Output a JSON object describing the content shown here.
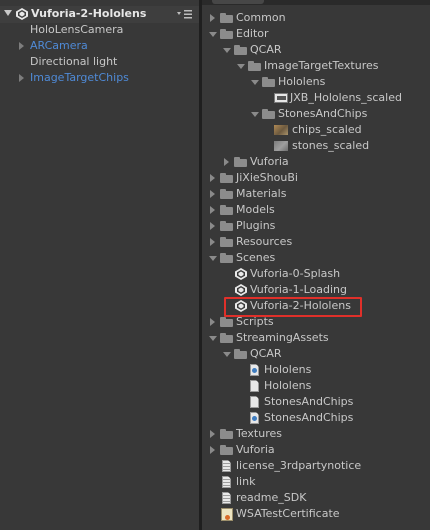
{
  "hierarchy": {
    "scene_name": "Vuforia-2-Hololens",
    "items": [
      {
        "label": "HoloLensCamera"
      },
      {
        "label": "ARCamera"
      },
      {
        "label": "Directional light"
      },
      {
        "label": "ImageTargetChips"
      }
    ]
  },
  "project": {
    "tree": [
      {
        "label": "Common"
      },
      {
        "label": "Editor"
      },
      {
        "label": "QCAR"
      },
      {
        "label": "ImageTargetTextures"
      },
      {
        "label": "Hololens"
      },
      {
        "label": "JXB_Hololens_scaled"
      },
      {
        "label": "StonesAndChips"
      },
      {
        "label": "chips_scaled"
      },
      {
        "label": "stones_scaled"
      },
      {
        "label": "Vuforia"
      },
      {
        "label": "JiXieShouBi"
      },
      {
        "label": "Materials"
      },
      {
        "label": "Models"
      },
      {
        "label": "Plugins"
      },
      {
        "label": "Resources"
      },
      {
        "label": "Scenes"
      },
      {
        "label": "Vuforia-0-Splash"
      },
      {
        "label": "Vuforia-1-Loading"
      },
      {
        "label": "Vuforia-2-Hololens"
      },
      {
        "label": "Scripts"
      },
      {
        "label": "StreamingAssets"
      },
      {
        "label": "QCAR"
      },
      {
        "label": "Hololens"
      },
      {
        "label": "Hololens"
      },
      {
        "label": "StonesAndChips"
      },
      {
        "label": "StonesAndChips"
      },
      {
        "label": "Textures"
      },
      {
        "label": "Vuforia"
      },
      {
        "label": "license_3rdpartynotice"
      },
      {
        "label": "link"
      },
      {
        "label": "readme_SDK"
      },
      {
        "label": "WSATestCertificate"
      }
    ]
  },
  "colors": {
    "panel_bg": "#383838",
    "text": "#c8c8c8",
    "prefab_text": "#4f8ad6",
    "highlight_border": "#e0302a"
  }
}
